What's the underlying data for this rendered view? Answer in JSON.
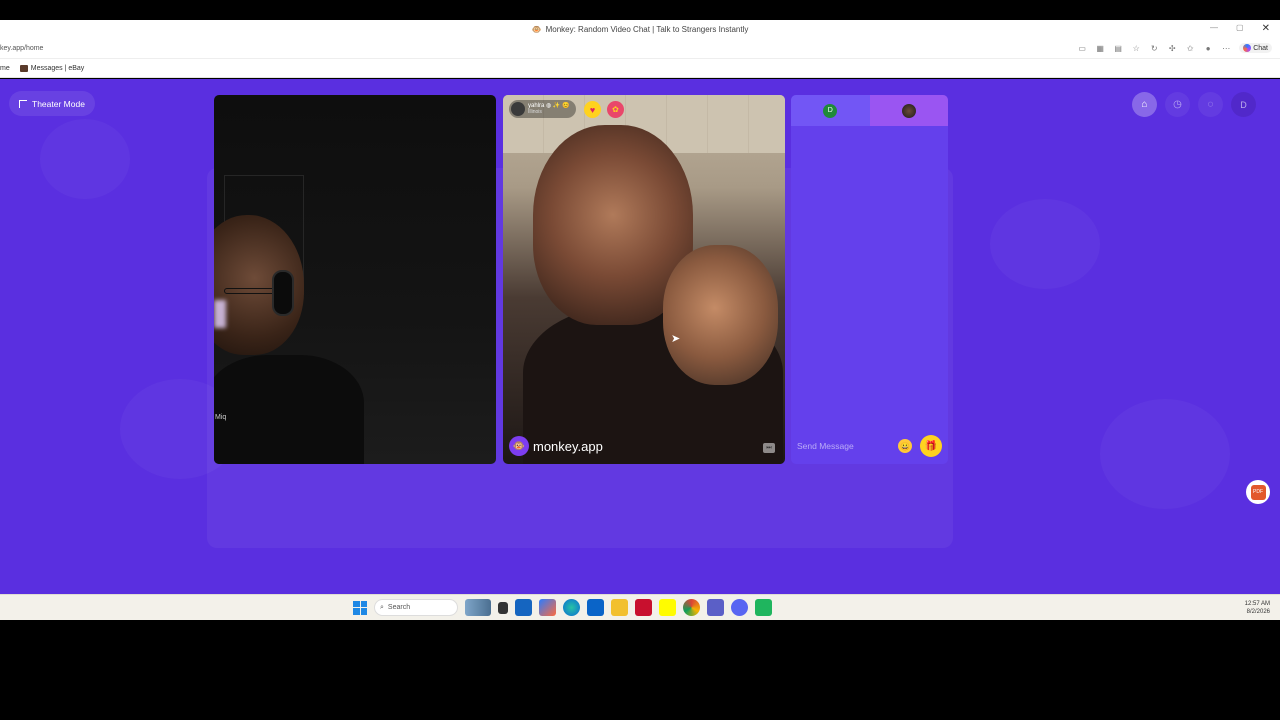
{
  "browser": {
    "title": "Monkey: Random Video Chat | Talk to Strangers Instantly",
    "favicon": "🐵",
    "window_controls": [
      "—",
      "▢",
      "✕"
    ],
    "url": "key.app/home",
    "toolbar_icons": [
      "camera-icon",
      "grid-icon",
      "reader-icon",
      "star-icon",
      "refresh-icon",
      "extensions-icon",
      "favorites-icon",
      "profile-icon",
      "more-icon"
    ],
    "copilot_label": "Chat",
    "bookmarks": [
      {
        "label": "me"
      },
      {
        "label": "Messages | eBay"
      }
    ]
  },
  "page": {
    "theater_label": "Theater Mode",
    "nav": [
      {
        "name": "home-icon",
        "glyph": "⌂"
      },
      {
        "name": "history-icon",
        "glyph": "◷"
      },
      {
        "name": "messages-icon",
        "glyph": "◌"
      },
      {
        "name": "profile-avatar",
        "glyph": "D"
      }
    ],
    "local_video": {
      "tag": "Miq"
    },
    "remote_video": {
      "username": "yahlra",
      "badges": "◍ ✨ 😊",
      "subline": "Illinois",
      "heart": "♥",
      "gift": "✿",
      "watermark_icon": "🐵",
      "watermark_text": "monkey.app",
      "corner_icon": "⏭"
    },
    "chat": {
      "me_initial": "D",
      "placeholder": "Send Message",
      "emoji": "😀",
      "gift": "🎁"
    },
    "pdf_badge": "PDF"
  },
  "taskbar": {
    "search_label": "Search",
    "time": "12:57 AM",
    "date": "8/2/2026"
  },
  "colors": {
    "page_bg": "#5a2fe0",
    "accent_yellow": "#ffd21f"
  }
}
